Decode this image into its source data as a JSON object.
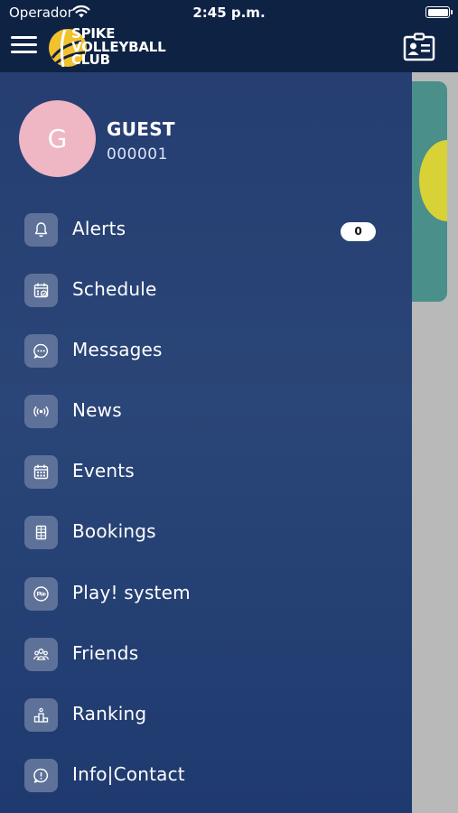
{
  "status_bar": {
    "carrier": "Operador",
    "time": "2:45 p.m."
  },
  "header": {
    "logo_lines": [
      "SPIKE",
      "VOLLEYBALL",
      "CLUB"
    ],
    "menu_icon": "hamburger-icon",
    "contact_icon": "contact-card-icon"
  },
  "user": {
    "avatar_initial": "G",
    "name": "GUEST",
    "id": "000001"
  },
  "menu": {
    "items": [
      {
        "label": "Alerts",
        "icon": "bell-icon",
        "badge": "0"
      },
      {
        "label": "Schedule",
        "icon": "calendar-check-icon"
      },
      {
        "label": "Messages",
        "icon": "chat-icon"
      },
      {
        "label": "News",
        "icon": "broadcast-icon"
      },
      {
        "label": "Events",
        "icon": "calendar-grid-icon"
      },
      {
        "label": "Bookings",
        "icon": "court-icon"
      },
      {
        "label": "Play! system",
        "icon": "play-badge-icon"
      },
      {
        "label": "Friends",
        "icon": "friends-icon"
      },
      {
        "label": "Ranking",
        "icon": "podium-icon"
      },
      {
        "label": "Info|Contact",
        "icon": "info-chat-icon"
      }
    ]
  },
  "colors": {
    "header_bg": "#0e2244",
    "drawer_bg": "#263e72",
    "icon_bg": "#5e7299",
    "avatar_bg": "#efb6c4",
    "logo_accent": "#f2c12e"
  }
}
